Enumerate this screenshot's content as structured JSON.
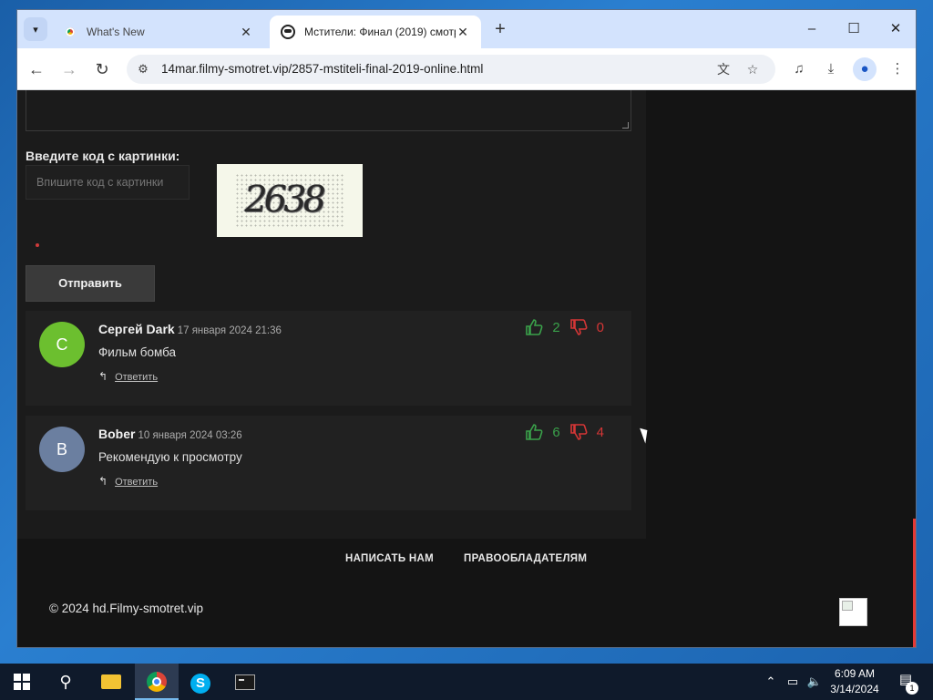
{
  "browser": {
    "tabs": [
      {
        "title": "What's New",
        "active": false
      },
      {
        "title": "Мстители: Финал (2019) смотр",
        "active": true
      }
    ],
    "url": "14mar.filmy-smotret.vip/2857-mstiteli-final-2019-online.html",
    "icons": {
      "tab_search": "chevron-down-icon",
      "new_tab": "+",
      "minimize": "–",
      "maximize": "☐",
      "close": "✕",
      "back": "←",
      "forward": "→",
      "reload": "↻",
      "translate": "文",
      "bookmark": "☆",
      "media": "♫",
      "download": "⤓",
      "profile": "●",
      "menu": "⋮"
    }
  },
  "form": {
    "captcha_label": "Введите код с картинки:",
    "captcha_placeholder": "Впишите код с картинки",
    "captcha_code": "2638",
    "submit_label": "Отправить"
  },
  "comments": [
    {
      "initial": "С",
      "avatar_color": "#6cbf2f",
      "author": "Сергей Dark",
      "date": "17 января 2024 21:36",
      "text": "Фильм бомба",
      "reply_label": "Ответить",
      "likes": "2",
      "dislikes": "0"
    },
    {
      "initial": "B",
      "avatar_color": "#6b7fa0",
      "author": "Bober",
      "date": "10 января 2024 03:26",
      "text": "Рекомендую к просмотру",
      "reply_label": "Ответить",
      "likes": "6",
      "dislikes": "4"
    }
  ],
  "footer": {
    "links": [
      "НАПИСАТЬ НАМ",
      "ПРАВООБЛАДАТЕЛЯМ"
    ],
    "copyright": "© 2024 hd.Filmy-smotret.vip"
  },
  "colors": {
    "like": "#3aa14a",
    "dislike": "#d53636",
    "page_bg": "#141414",
    "content_bg": "#1b1b1b"
  },
  "taskbar": {
    "time": "6:09 AM",
    "date": "3/14/2024",
    "notifications": "1",
    "icons": [
      "windows-start-icon",
      "search-icon",
      "file-explorer-icon",
      "chrome-icon",
      "skype-icon",
      "terminal-icon"
    ]
  }
}
